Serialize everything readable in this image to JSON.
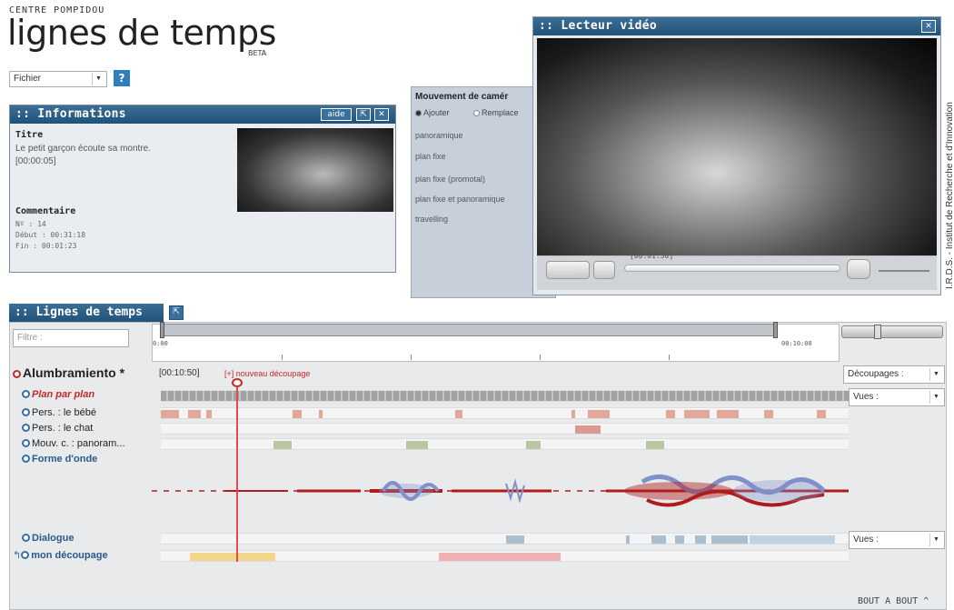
{
  "header": {
    "institution": "CENTRE POMPIDOU",
    "app_title": "lignes de temps",
    "beta": "BETA",
    "menu_value": "Fichier",
    "help": "?"
  },
  "info_panel": {
    "title": ":: Informations",
    "aide": "aide",
    "titre_label": "Titre",
    "titre_value": "Le petit garçon écoute sa montre.",
    "timecode": "[00:00:05]",
    "commentaire_label": "Commentaire",
    "num": "Nº : 14",
    "debut": "Début : 00:31:18",
    "fin": "Fin : 00:01:23"
  },
  "camera_panel": {
    "title": "Mouvement de camér",
    "ajouter": "Ajouter",
    "remplacer": "Remplace",
    "items": [
      "panoramique",
      "plan fixe",
      "plan fixe (promotal)",
      "plan fixe et panoramique",
      "travelling"
    ]
  },
  "video_panel": {
    "title": ":: Lecteur vidéo",
    "timecode": "[00:01:30]"
  },
  "side_text": "I.R.D.S. - Institut de Recherche et d'Innovation",
  "timeline": {
    "title": ":: Lignes de temps",
    "filter_placeholder": "Filtre :",
    "start": "0:00",
    "end": "00:10:00",
    "film_title": "Alumbramiento",
    "asterisk": "*",
    "current_time": "[00:10:50]",
    "new_cut": "[+] nouveau découpage",
    "tracks": [
      {
        "label": "Plan par plan",
        "style": "italic-red"
      },
      {
        "label": "Pers. : le bébé"
      },
      {
        "label": "Pers. : le chat"
      },
      {
        "label": "Mouv. c. : panoram..."
      },
      {
        "label": "Forme d'onde",
        "style": "bold"
      },
      {
        "label": "Dialogue",
        "style": "bold"
      },
      {
        "label": "mon découpage",
        "style": "bold"
      }
    ],
    "decoupages": "Découpages :",
    "vues": "Vues :",
    "vues2": "Vues :",
    "footer": "BOUT A BOUT ^"
  },
  "colors": {
    "title_bar": "#20527a",
    "accent_red": "#c62828",
    "baby": "#e3a79a",
    "chat": "#d89a92",
    "panoram": "#b8c7a0",
    "dialogue": "#a9bfd0",
    "decoupage_yellow": "#f1d68c",
    "decoupage_pink": "#efb1b1"
  }
}
